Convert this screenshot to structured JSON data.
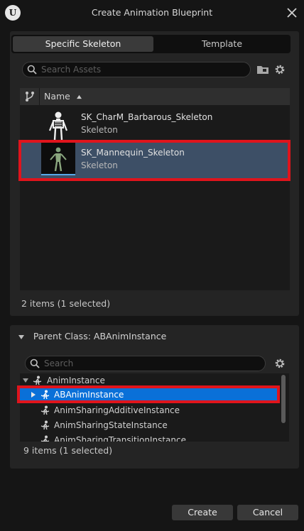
{
  "window": {
    "title": "Create Animation Blueprint",
    "logo_icon": "unreal-engine-logo",
    "close_icon": "close-icon"
  },
  "tabs": [
    {
      "label": "Specific Skeleton",
      "active": true
    },
    {
      "label": "Template",
      "active": false
    }
  ],
  "asset_search": {
    "placeholder": "Search Assets",
    "value": ""
  },
  "asset_list": {
    "column_header": "Name",
    "sort": "ascending",
    "items": [
      {
        "name": "SK_CharM_Barbarous_Skeleton",
        "type": "Skeleton",
        "selected": false
      },
      {
        "name": "SK_Mannequin_Skeleton",
        "type": "Skeleton",
        "selected": true
      }
    ],
    "status": "2 items (1 selected)"
  },
  "parent_class": {
    "header": "Parent Class: ABAnimInstance",
    "search": {
      "placeholder": "Search",
      "value": ""
    },
    "tree": [
      {
        "label": "AnimInstance",
        "level": 0,
        "expanded": true,
        "selected": false
      },
      {
        "label": "ABAnimInstance",
        "level": 1,
        "expanded": false,
        "selected": true
      },
      {
        "label": "AnimSharingAdditiveInstance",
        "level": 1,
        "selected": false
      },
      {
        "label": "AnimSharingStateInstance",
        "level": 1,
        "selected": false
      },
      {
        "label": "AnimSharingTransitionInstance",
        "level": 1,
        "selected": false
      }
    ],
    "status": "9 items (1 selected)"
  },
  "buttons": {
    "create": "Create",
    "cancel": "Cancel"
  },
  "colors": {
    "selection_row": "#0a70d8",
    "selected_asset_row": "#3d4f66",
    "annotation_box": "#e0141c"
  }
}
